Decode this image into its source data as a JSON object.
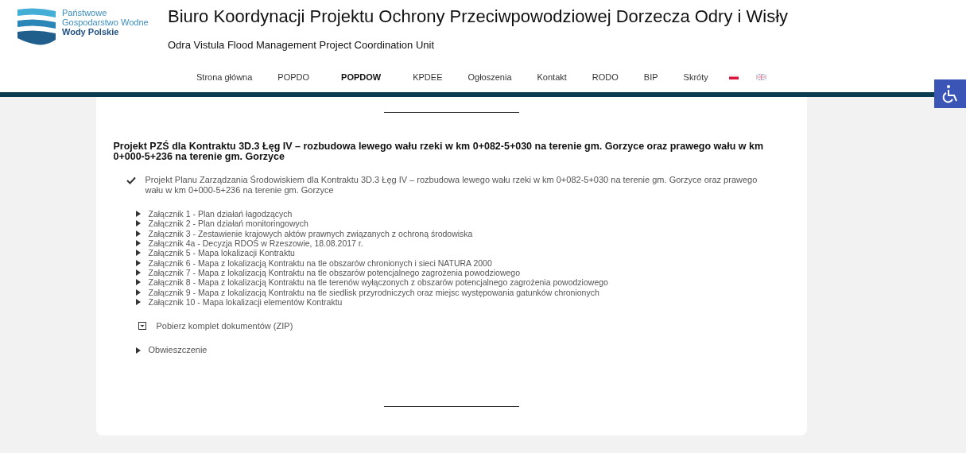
{
  "logo": {
    "line_1": "Państwowe",
    "line_2": "Gospodarstwo Wodne",
    "line_3": "Wody Polskie"
  },
  "header": {
    "title": "Biuro Koordynacji Projektu Ochrony Przeciwpowodziowej Dorzecza Odry i Wisły",
    "subtitle": "Odra Vistula Flood Management Project Coordination Unit"
  },
  "nav": [
    {
      "label": "Strona główna",
      "selected": false
    },
    {
      "label": "POPDO",
      "selected": false
    },
    {
      "label": "POPDOW",
      "selected": true
    },
    {
      "label": "KPDEE",
      "selected": false
    },
    {
      "label": "Ogłoszenia",
      "selected": false
    },
    {
      "label": "Kontakt",
      "selected": false
    },
    {
      "label": "RODO",
      "selected": false
    },
    {
      "label": "BIP",
      "selected": false
    },
    {
      "label": "Skróty",
      "selected": false
    }
  ],
  "languages": [
    {
      "kind": "pl"
    },
    {
      "kind": "en"
    }
  ],
  "article": {
    "title": "Projekt PZŚ dla Kontraktu 3D.3 Łęg IV – rozbudowa lewego wału rzeki w km 0+082-5+030 na terenie gm. Gorzyce oraz prawego wału w km 0+000-5+236 na terenie gm. Gorzyce",
    "main_document": "Projekt Planu Zarządzania Środowiskiem dla Kontraktu 3D.3 Łęg IV – rozbudowa lewego wału rzeki w km 0+082-5+030 na terenie gm. Gorzyce oraz prawego wału w km 0+000-5+236 na terenie gm. Gorzyce",
    "attachments": [
      "Załącznik 1 - Plan działań łagodzących",
      "Załącznik 2 - Plan działań monitoringowych",
      "Załącznik 3 - Zestawienie krajowych aktów prawnych związanych z ochroną środowiska",
      "Załącznik 4a - Decyzja RDOŚ w Rzeszowie, 18.08.2017 r.",
      "Załącznik 5 - Mapa lokalizacji Kontraktu",
      "Załącznik 6 - Mapa z lokalizacją Kontraktu na tle obszarów chronionych i sieci NATURA 2000",
      "Załącznik 7 - Mapa z lokalizacją Kontraktu na tle obszarów potencjalnego zagrożenia powodziowego",
      "Załącznik 8 - Mapa z lokalizacją Kontraktu na tle terenów wyłączonych z obszarów potencjalnego zagrożenia powodziowego",
      "Załącznik 9 - Mapa z lokalizacją Kontraktu na tle siedlisk przyrodniczych oraz miejsc występowania gatunków chronionych",
      "Załącznik 10 - Mapa lokalizacji elementów Kontraktu"
    ],
    "download": "Pobierz komplet dokumentów (ZIP)",
    "notice": "Obwieszczenie"
  }
}
